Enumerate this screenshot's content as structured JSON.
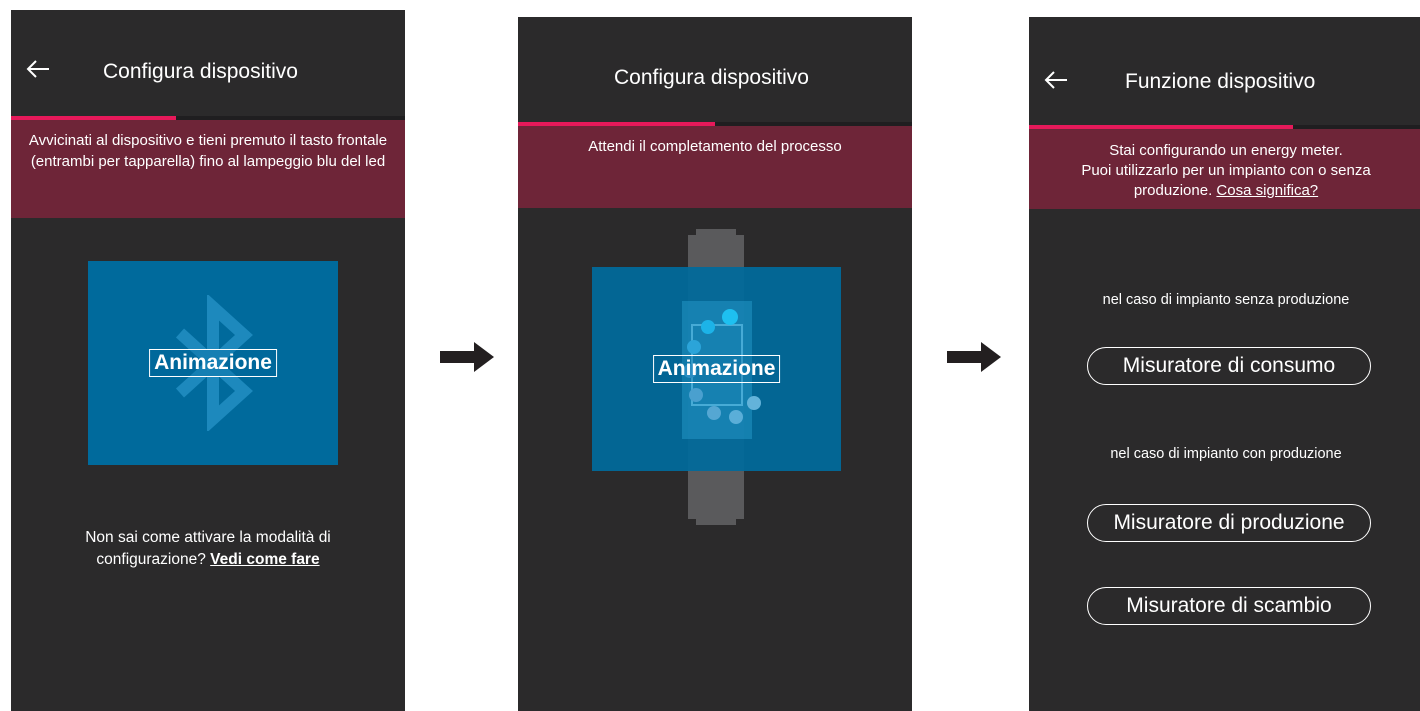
{
  "screens": [
    {
      "title": "Configura dispositivo",
      "progress": 0.42,
      "banner": "Avvicinati al dispositivo e tieni premuto il tasto frontale (entrambi per tapparella) fino al lampeggio blu del led",
      "animation_label": "Animazione",
      "help_text_1": "Non sai come attivare la modalità di",
      "help_text_2": "configurazione?",
      "help_link": "Vedi come fare"
    },
    {
      "title": "Configura dispositivo",
      "progress": 0.5,
      "banner": "Attendi il completamento del processo",
      "animation_label": "Animazione"
    },
    {
      "title": "Funzione dispositivo",
      "progress": 0.67,
      "banner_line1": "Stai configurando un energy meter.",
      "banner_line2": "Puoi utilizzarlo per un impianto con o senza",
      "banner_line3": "produzione.",
      "banner_link": "Cosa significa?",
      "section1_label": "nel caso di impianto senza produzione",
      "button_consumo": "Misuratore di consumo",
      "section2_label": "nel caso di impianto con produzione",
      "button_produzione": "Misuratore di produzione",
      "button_scambio": "Misuratore di scambio"
    }
  ],
  "colors": {
    "screen_bg": "#2b2a2b",
    "banner_bg": "#6e2538",
    "progress_accent": "#e6195a",
    "animation_bg": "#006a9c"
  },
  "icons": [
    "back-arrow-icon",
    "bluetooth-icon",
    "loading-dots-icon",
    "device-module-icon",
    "flow-arrow-icon"
  ]
}
